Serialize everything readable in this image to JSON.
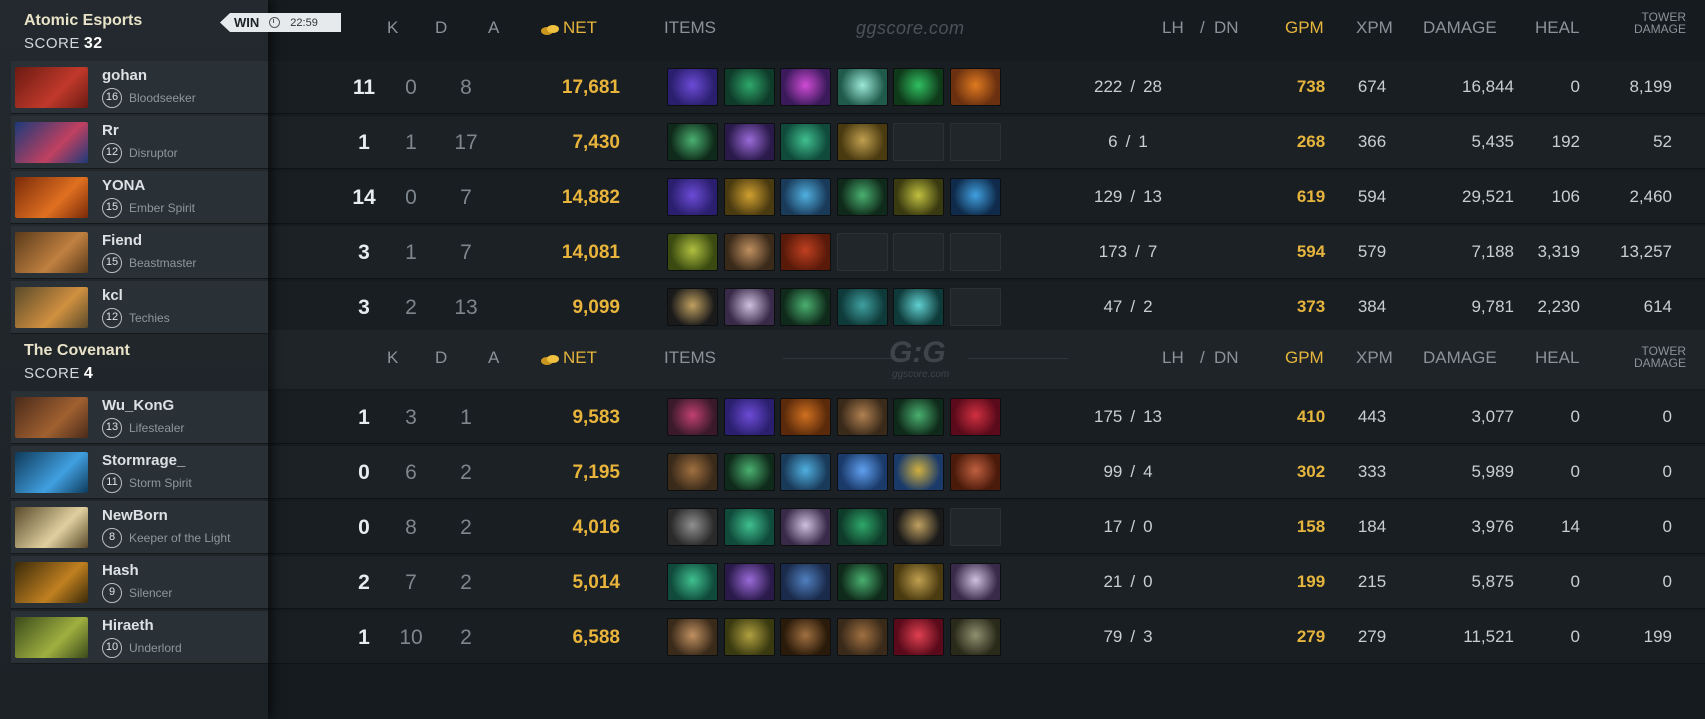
{
  "headers": {
    "k": "K",
    "d": "D",
    "a": "A",
    "net": "NET",
    "items": "ITEMS",
    "lh": "LH",
    "slash": "/",
    "dn": "DN",
    "gpm": "GPM",
    "xpm": "XPM",
    "damage": "DAMAGE",
    "heal": "HEAL",
    "tower_line1": "TOWER",
    "tower_line2": "DAMAGE",
    "watermark": "ggscore.com",
    "logo": "G:G",
    "logo_sub": "ggscore.com"
  },
  "badge": {
    "result": "WIN",
    "time": "22:59"
  },
  "colors": {
    "gold": "#e5b53d",
    "panel": "#2a3136",
    "background": "#161b1f"
  },
  "teams": [
    {
      "name": "Atomic Esports",
      "score_label": "SCORE",
      "score": "32",
      "players": [
        {
          "name": "gohan",
          "level": "16",
          "hero": "Bloodseeker",
          "k": "11",
          "d": "0",
          "a": "8",
          "net": "17,681",
          "lh": "222",
          "dn": "28",
          "gpm": "738",
          "xpm": "674",
          "damage": "16,844",
          "heal": "0",
          "tower": "8,199",
          "avatar": [
            "#6b1a12",
            "#c0392b"
          ],
          "items": [
            [
              "#2a1f6e",
              "#6c4bd6"
            ],
            [
              "#0f3b2a",
              "#2ea86a"
            ],
            [
              "#3a1a5a",
              "#d04bd6"
            ],
            [
              "#1f5a4a",
              "#9ce8d8"
            ],
            [
              "#0f3a1a",
              "#30c060"
            ],
            [
              "#6a3010",
              "#e07a20"
            ]
          ]
        },
        {
          "name": "Rr",
          "level": "12",
          "hero": "Disruptor",
          "k": "1",
          "d": "1",
          "a": "17",
          "net": "7,430",
          "lh": "6",
          "dn": "1",
          "gpm": "268",
          "xpm": "366",
          "damage": "5,435",
          "heal": "192",
          "tower": "52",
          "avatar": [
            "#1c3a7a",
            "#c04060"
          ],
          "items": [
            [
              "#0f2a1a",
              "#4ab070"
            ],
            [
              "#2a1a4a",
              "#9a6ad8"
            ],
            [
              "#0f4a3a",
              "#40c090"
            ],
            [
              "#4a3a10",
              "#c0a050"
            ],
            null,
            null
          ]
        },
        {
          "name": "YONA",
          "level": "15",
          "hero": "Ember Spirit",
          "k": "14",
          "d": "0",
          "a": "7",
          "net": "14,882",
          "lh": "129",
          "dn": "13",
          "gpm": "619",
          "xpm": "594",
          "damage": "29,521",
          "heal": "106",
          "tower": "2,460",
          "avatar": [
            "#7a2a0a",
            "#e07020"
          ],
          "items": [
            [
              "#2a1f6e",
              "#6c4bd6"
            ],
            [
              "#4a3a10",
              "#d0a030"
            ],
            [
              "#1a3a5a",
              "#50b0e0"
            ],
            [
              "#0f2a1a",
              "#4ab070"
            ],
            [
              "#3a3a10",
              "#c0c040"
            ],
            [
              "#0f2a4a",
              "#40a0e0"
            ]
          ]
        },
        {
          "name": "Fiend",
          "level": "15",
          "hero": "Beastmaster",
          "k": "3",
          "d": "1",
          "a": "7",
          "net": "14,081",
          "lh": "173",
          "dn": "7",
          "gpm": "594",
          "xpm": "579",
          "damage": "7,188",
          "heal": "3,319",
          "tower": "13,257",
          "avatar": [
            "#5a3a1a",
            "#c08040"
          ],
          "items": [
            [
              "#3a4a10",
              "#b0c040"
            ],
            [
              "#3a2a1a",
              "#c09060"
            ],
            [
              "#5a1a0a",
              "#c04020"
            ],
            null,
            null,
            null
          ]
        },
        {
          "name": "kcl",
          "level": "12",
          "hero": "Techies",
          "k": "3",
          "d": "2",
          "a": "13",
          "net": "9,099",
          "lh": "47",
          "dn": "2",
          "gpm": "373",
          "xpm": "384",
          "damage": "9,781",
          "heal": "2,230",
          "tower": "614",
          "avatar": [
            "#5a4a2a",
            "#d09040"
          ],
          "items": [
            [
              "#1a1a1a",
              "#c0a060"
            ],
            [
              "#3a2a4a",
              "#d0c0e0"
            ],
            [
              "#0f2a1a",
              "#4ab070"
            ],
            [
              "#0f3a3a",
              "#40a0a0"
            ],
            [
              "#0f3a3a",
              "#60d0d0"
            ],
            null
          ]
        }
      ]
    },
    {
      "name": "The Covenant",
      "score_label": "SCORE",
      "score": "4",
      "players": [
        {
          "name": "Wu_KonG",
          "level": "13",
          "hero": "Lifestealer",
          "k": "1",
          "d": "3",
          "a": "1",
          "net": "9,583",
          "lh": "175",
          "dn": "13",
          "gpm": "410",
          "xpm": "443",
          "damage": "3,077",
          "heal": "0",
          "tower": "0",
          "avatar": [
            "#4a2a1a",
            "#a06030"
          ],
          "items": [
            [
              "#3a1a2a",
              "#c04070"
            ],
            [
              "#2a1f6e",
              "#6c4bd6"
            ],
            [
              "#5a2a0a",
              "#d07020"
            ],
            [
              "#3a2a1a",
              "#b08050"
            ],
            [
              "#0f2a1a",
              "#4ab070"
            ],
            [
              "#5a0a1a",
              "#d03040"
            ]
          ]
        },
        {
          "name": "Stormrage_",
          "level": "11",
          "hero": "Storm Spirit",
          "k": "0",
          "d": "6",
          "a": "2",
          "net": "7,195",
          "lh": "99",
          "dn": "4",
          "gpm": "302",
          "xpm": "333",
          "damage": "5,989",
          "heal": "0",
          "tower": "0",
          "avatar": [
            "#0f3a5a",
            "#40a0e0"
          ],
          "items": [
            [
              "#3a2a1a",
              "#a07040"
            ],
            [
              "#0f2a1a",
              "#4ab070"
            ],
            [
              "#1a3a5a",
              "#50b0e0"
            ],
            [
              "#1a3a6a",
              "#60a0f0"
            ],
            [
              "#1a3a6a",
              "#d0b040"
            ],
            [
              "#4a1a0a",
              "#c06040"
            ]
          ]
        },
        {
          "name": "NewBorn",
          "level": "8",
          "hero": "Keeper of the Light",
          "k": "0",
          "d": "8",
          "a": "2",
          "net": "4,016",
          "lh": "17",
          "dn": "0",
          "gpm": "158",
          "xpm": "184",
          "damage": "3,976",
          "heal": "14",
          "tower": "0",
          "avatar": [
            "#5a4a2a",
            "#e0d0a0"
          ],
          "items": [
            [
              "#2a2a2a",
              "#909090"
            ],
            [
              "#0f4a3a",
              "#40c090"
            ],
            [
              "#3a2a4a",
              "#d0c0e0"
            ],
            [
              "#0f3b2a",
              "#2ea86a"
            ],
            [
              "#1a1a1a",
              "#c0a060"
            ],
            null
          ]
        },
        {
          "name": "Hash",
          "level": "9",
          "hero": "Silencer",
          "k": "2",
          "d": "7",
          "a": "2",
          "net": "5,014",
          "lh": "21",
          "dn": "0",
          "gpm": "199",
          "xpm": "215",
          "damage": "5,875",
          "heal": "0",
          "tower": "0",
          "avatar": [
            "#3a2a0a",
            "#c08020"
          ],
          "items": [
            [
              "#0f4a3a",
              "#40c090"
            ],
            [
              "#2a1a4a",
              "#9a6ad8"
            ],
            [
              "#1a2a4a",
              "#5080c0"
            ],
            [
              "#0f2a1a",
              "#4ab070"
            ],
            [
              "#4a3a10",
              "#c0a050"
            ],
            [
              "#3a2a4a",
              "#d0c0e0"
            ]
          ]
        },
        {
          "name": "Hiraeth",
          "level": "10",
          "hero": "Underlord",
          "k": "1",
          "d": "10",
          "a": "2",
          "net": "6,588",
          "lh": "79",
          "dn": "3",
          "gpm": "279",
          "xpm": "279",
          "damage": "11,521",
          "heal": "0",
          "tower": "199",
          "avatar": [
            "#3a4a1a",
            "#a0b040"
          ],
          "items": [
            [
              "#3a2a1a",
              "#c09060"
            ],
            [
              "#3a3a10",
              "#b0a040"
            ],
            [
              "#2a1a0a",
              "#a07040"
            ],
            [
              "#3a2a1a",
              "#a07040"
            ],
            [
              "#5a0a1a",
              "#e04050"
            ],
            [
              "#2a2a1a",
              "#909070"
            ]
          ]
        }
      ]
    }
  ]
}
